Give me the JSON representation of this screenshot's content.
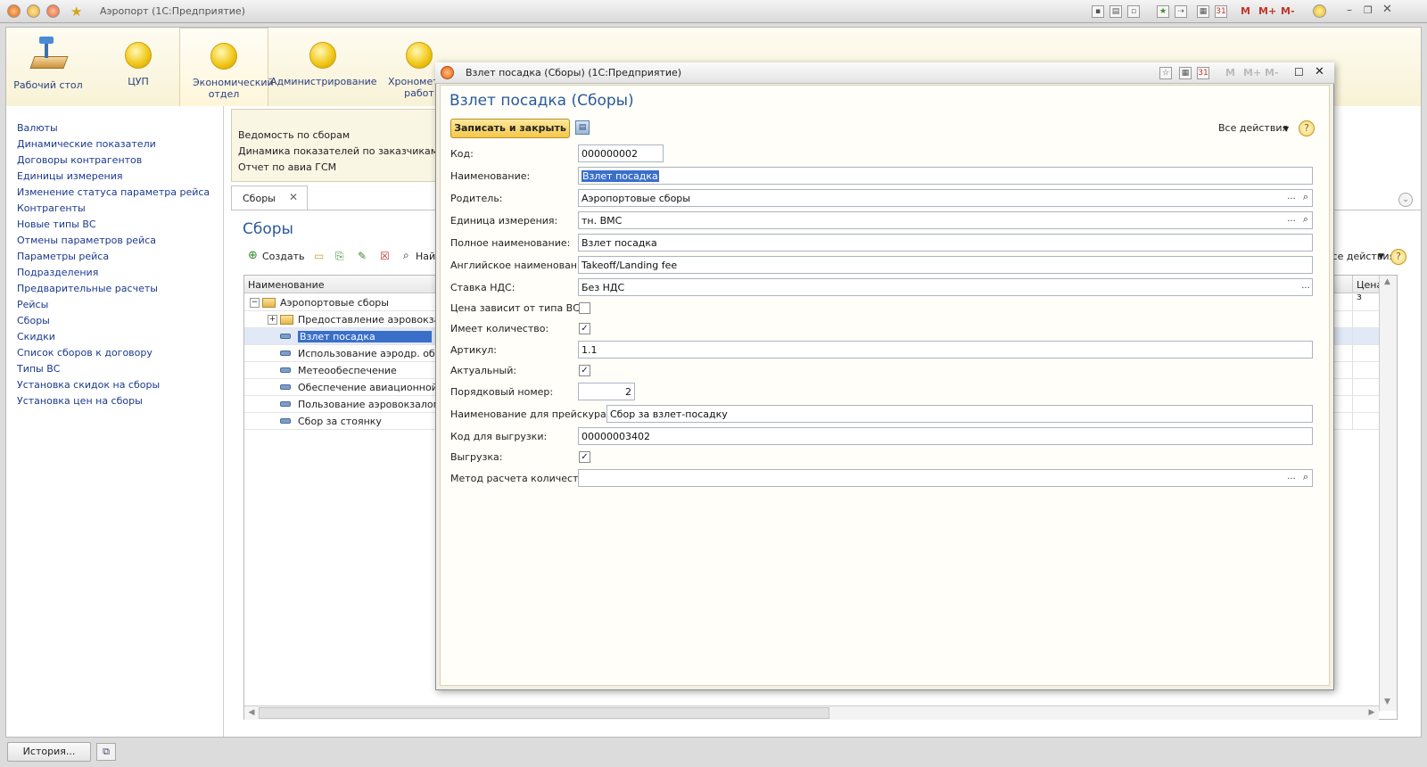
{
  "app": {
    "title": "Аэропорт (1С:Предприятие)"
  },
  "toolbar_right": {
    "m": "M",
    "m_plus": "M+",
    "m_minus": "M-"
  },
  "ribbon": [
    {
      "label": "Рабочий стол",
      "icon": "desktop-icon"
    },
    {
      "label": "ЦУП",
      "icon": "orb-icon"
    },
    {
      "label": "Экономический отдел",
      "icon": "orb-icon",
      "active": true
    },
    {
      "label": "Администрирование",
      "icon": "orb-icon"
    },
    {
      "label": "Хронометраж работ",
      "icon": "orb-icon"
    }
  ],
  "nav": [
    "Валюты",
    "Динамические показатели",
    "Договоры контрагентов",
    "Единицы измерения",
    "Изменение статуса параметра рейса",
    "Контрагенты",
    "Новые типы ВС",
    "Отмены параметров рейса",
    "Параметры рейса",
    "Подразделения",
    "Предварительные расчеты",
    "Рейсы",
    "Сборы",
    "Скидки",
    "Список сборов к договору",
    "Типы ВС",
    "Установка скидок на сборы",
    "Установка цен на сборы"
  ],
  "functions": [
    "Ведомость по сборам",
    "Динамика показателей по заказчикам",
    "Отчет по авиа ГСМ"
  ],
  "list": {
    "tab": "Сборы",
    "title": "Сборы",
    "create": "Создать",
    "find": "Най",
    "all_actions": "Все действия",
    "col_name": "Наименование",
    "col_price": "Цена з",
    "rows": [
      {
        "name": "Аэропортовые сборы",
        "type": "folder",
        "level": 0
      },
      {
        "name": "Предоставление аэровокзаль",
        "type": "folder",
        "level": 1
      },
      {
        "name": "Взлет посадка",
        "type": "item",
        "level": 1,
        "selected": true
      },
      {
        "name": "Использование аэродр. обсл.",
        "type": "item",
        "level": 1
      },
      {
        "name": "Метеообеспечение",
        "type": "item",
        "level": 1
      },
      {
        "name": "Обеспечение авиационной бе",
        "type": "item",
        "level": 1
      },
      {
        "name": "Пользование аэровокзалом",
        "type": "item",
        "level": 1
      },
      {
        "name": "Сбор за стоянку",
        "type": "item",
        "level": 1
      }
    ]
  },
  "status": {
    "history": "История..."
  },
  "dialog": {
    "window_title": "Взлет посадка (Сборы) (1С:Предприятие)",
    "heading": "Взлет посадка (Сборы)",
    "save_close": "Записать и закрыть",
    "all_actions": "Все действия",
    "help": "?",
    "fields": {
      "code": {
        "label": "Код:",
        "value": "000000002"
      },
      "name": {
        "label": "Наименование:",
        "value": "Взлет посадка"
      },
      "parent": {
        "label": "Родитель:",
        "value": "Аэропортовые сборы"
      },
      "unit": {
        "label": "Единица измерения:",
        "value": "тн. ВМС"
      },
      "full_name": {
        "label": "Полное наименование:",
        "value": "Взлет посадка"
      },
      "english": {
        "label": "Английское наименование:",
        "value": "Takeoff/Landing fee"
      },
      "vat": {
        "label": "Ставка НДС:",
        "value": "Без НДС"
      },
      "price_depends": {
        "label": "Цена зависит от типа ВС:",
        "checked": false
      },
      "has_qty": {
        "label": "Имеет количество:",
        "checked": true
      },
      "article": {
        "label": "Артикул:",
        "value": "1.1"
      },
      "actual": {
        "label": "Актуальный:",
        "checked": true
      },
      "order": {
        "label": "Порядковый номер:",
        "value": "2"
      },
      "price_list_name": {
        "label": "Наименование для прейскуранта:",
        "value": "Сбор за взлет-посадку"
      },
      "export_code": {
        "label": "Код для выгрузки:",
        "value": "00000003402"
      },
      "export": {
        "label": "Выгрузка:",
        "checked": true
      },
      "qty_method": {
        "label": "Метод расчета количества:",
        "value": ""
      }
    }
  },
  "colors": {
    "accent": "#2a5a9a",
    "selection": "#3a6fc9",
    "button": "#f4c84a"
  }
}
